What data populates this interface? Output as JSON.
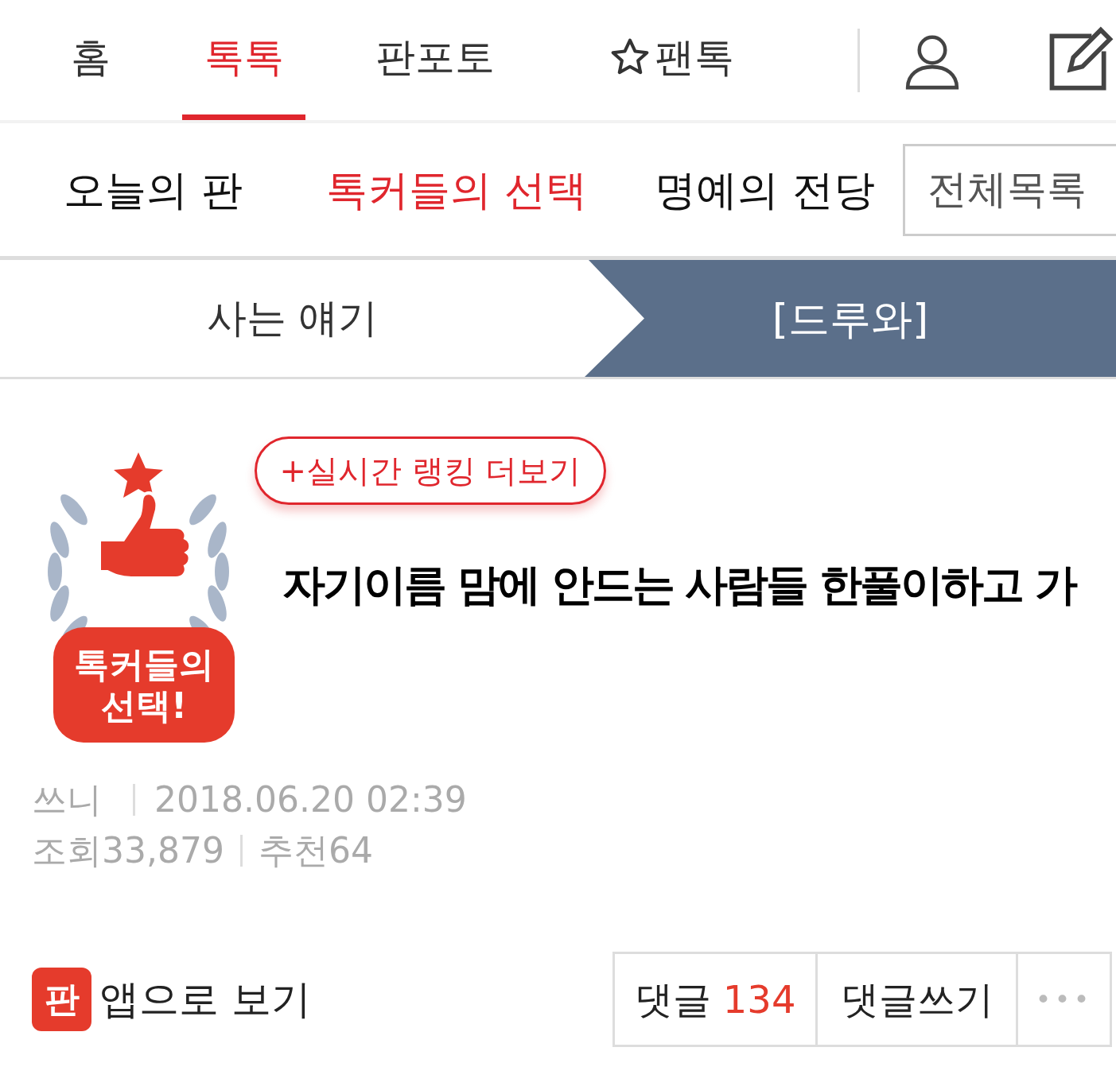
{
  "top_nav": [
    {
      "label": "홈",
      "selected": false,
      "kind": "plain"
    },
    {
      "label": "톡톡",
      "selected": true,
      "kind": "plain"
    },
    {
      "label": "판포토",
      "selected": false,
      "kind": "plain"
    },
    {
      "label": "팬톡",
      "selected": false,
      "kind": "starred"
    }
  ],
  "sub_nav": [
    {
      "label": "오늘의 판",
      "selected": false
    },
    {
      "label": "톡커들의 선택",
      "selected": true
    },
    {
      "label": "명예의 전당",
      "selected": false
    }
  ],
  "all_list_button": "전체목록",
  "breadcrumb": {
    "category": "사는 얘기",
    "board": "[드루와]"
  },
  "badge": {
    "lines": [
      "톡커들의",
      "선택!"
    ]
  },
  "ranking_button": "+실시간 랭킹 더보기",
  "post": {
    "title": "자기이름 맘에 안드는 사람들 한풀이하고 가",
    "author": "쓰니",
    "date": "2018.06.20 02:39",
    "views_label": "조회",
    "views": "33,879",
    "likes_label": "추천",
    "likes": "64"
  },
  "app_link": {
    "icon_text": "판",
    "label": "앱으로 보기"
  },
  "actions": {
    "comments_label": "댓글",
    "comments_count": "134",
    "write_comment": "댓글쓰기",
    "more": "•••"
  }
}
